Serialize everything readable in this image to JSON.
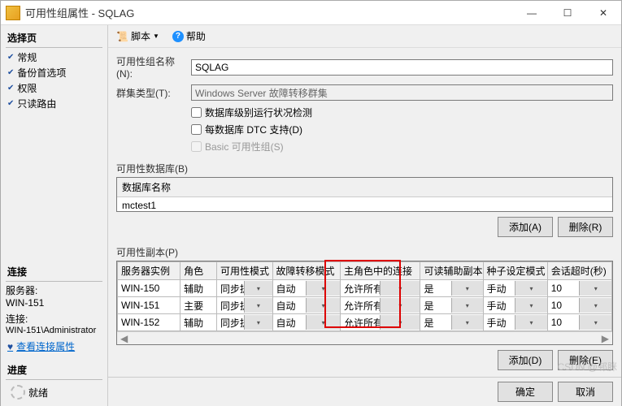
{
  "window": {
    "title": "可用性组属性 - SQLAG"
  },
  "winbtns": {
    "min": "—",
    "max": "☐",
    "close": "✕"
  },
  "sidebar": {
    "select_hdr": "选择页",
    "pages": [
      "常规",
      "备份首选项",
      "权限",
      "只读路由"
    ],
    "conn_hdr": "连接",
    "server_lbl": "服务器:",
    "server_val": "WIN-151",
    "conn_lbl": "连接:",
    "conn_val": "WIN-151\\Administrator",
    "view_link": "查看连接属性",
    "progress_hdr": "进度",
    "status": "就绪"
  },
  "toolbar": {
    "script": "脚本",
    "help": "帮助",
    "dd": "▼"
  },
  "form": {
    "name_lbl": "可用性组名称(N):",
    "name_val": "SQLAG",
    "cluster_lbl": "群集类型(T):",
    "cluster_val": "Windows Server 故障转移群集",
    "chk1": "数据库级别运行状况检测",
    "chk2": "每数据库 DTC 支持(D)",
    "chk3": "Basic 可用性组(S)"
  },
  "dbs": {
    "hdr": "可用性数据库(B)",
    "col": "数据库名称",
    "rows": [
      "mctest1"
    ]
  },
  "buttons": {
    "add_a": "添加(A)",
    "del_r": "删除(R)",
    "add_d": "添加(D)",
    "del_e": "删除(E)",
    "ok": "确定",
    "cancel": "取消"
  },
  "replicas": {
    "hdr": "可用性副本(P)",
    "cols": [
      "服务器实例",
      "角色",
      "可用性模式",
      "故障转移模式",
      "主角色中的连接",
      "可读辅助副本",
      "种子设定模式",
      "会话超时(秒)"
    ],
    "rows": [
      {
        "server": "WIN-150",
        "role": "辅助",
        "mode": "同步提交",
        "failover": "自动",
        "primary_conn": "允许所有连接",
        "readable": "是",
        "seed": "手动",
        "timeout": "10"
      },
      {
        "server": "WIN-151",
        "role": "主要",
        "mode": "同步提交",
        "failover": "自动",
        "primary_conn": "允许所有连接",
        "readable": "是",
        "seed": "手动",
        "timeout": "10"
      },
      {
        "server": "WIN-152",
        "role": "辅助",
        "mode": "同步提交",
        "failover": "自动",
        "primary_conn": "允许所有连接",
        "readable": "是",
        "seed": "手动",
        "timeout": "10"
      }
    ]
  },
  "watermark": "CSDN @邨脒"
}
